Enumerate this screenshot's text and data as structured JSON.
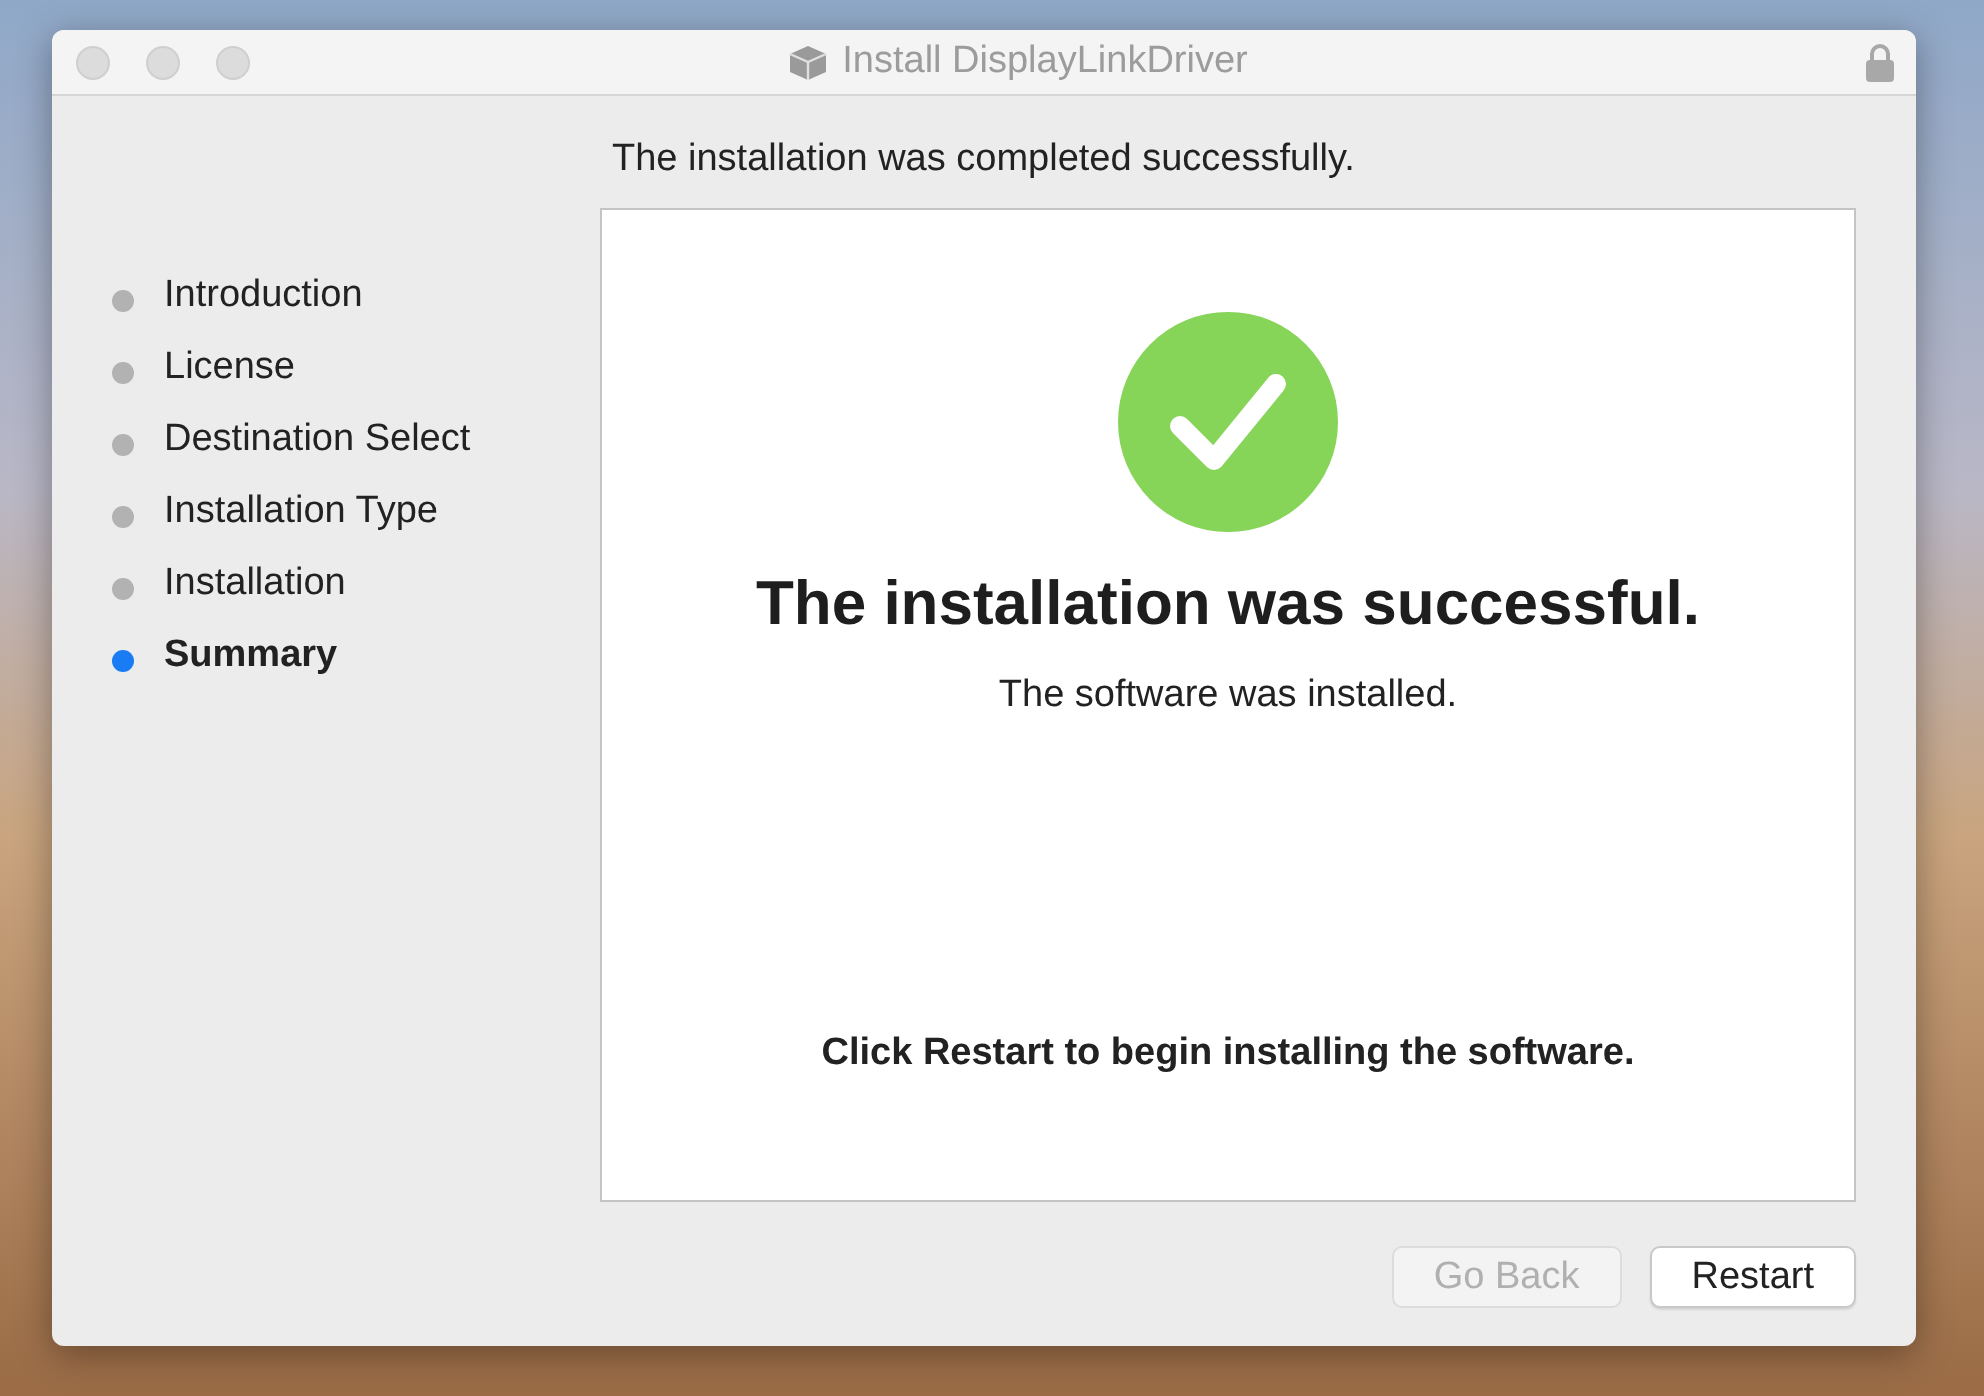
{
  "window": {
    "title": "Install DisplayLinkDriver"
  },
  "header": "The installation was completed successfully.",
  "steps": [
    {
      "label": "Introduction",
      "selected": false
    },
    {
      "label": "License",
      "selected": false
    },
    {
      "label": "Destination Select",
      "selected": false
    },
    {
      "label": "Installation Type",
      "selected": false
    },
    {
      "label": "Installation",
      "selected": false
    },
    {
      "label": "Summary",
      "selected": true
    }
  ],
  "panel": {
    "heading": "The installation was successful.",
    "subtitle": "The software was installed.",
    "note": "Click Restart to begin installing the software."
  },
  "buttons": [
    {
      "label": "Go Back",
      "disabled": true
    },
    {
      "label": "Restart",
      "disabled": false
    }
  ]
}
